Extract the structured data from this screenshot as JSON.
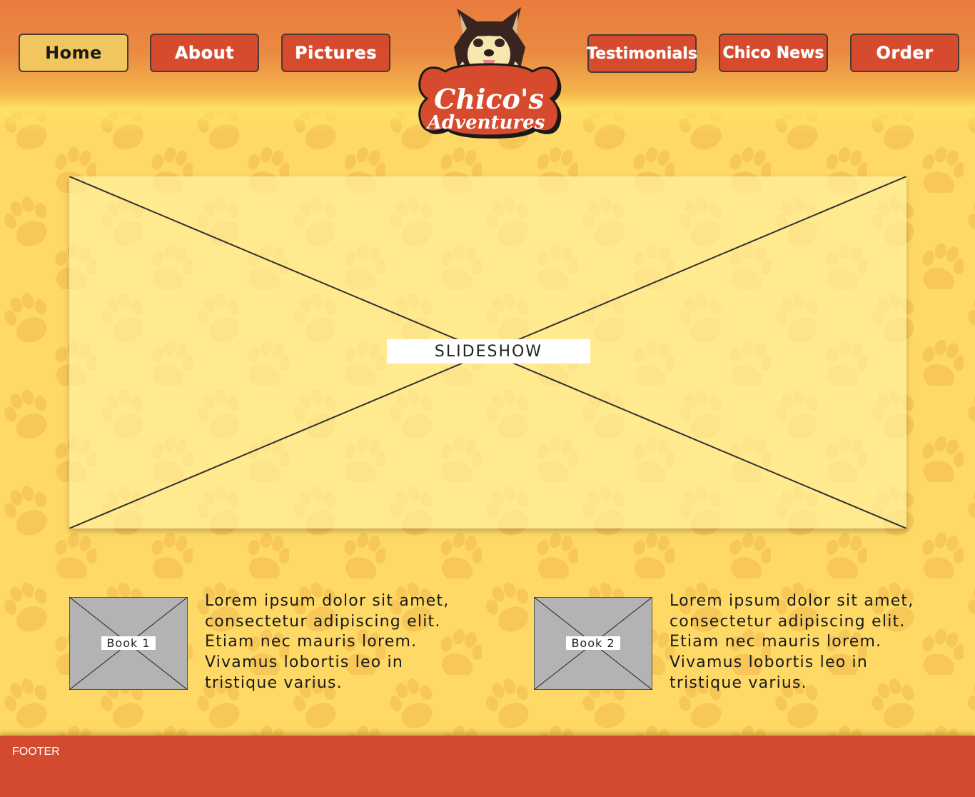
{
  "nav": {
    "home": "Home",
    "about": "About",
    "pictures": "Pictures",
    "testimonials": "Testimonials",
    "chico_news": "Chico News",
    "order": "Order"
  },
  "logo": {
    "line1": "Chico's",
    "line2": "Adventures"
  },
  "slideshow": {
    "label": "SLIDESHOW"
  },
  "books": [
    {
      "label": "Book 1",
      "text": "Lorem ipsum dolor sit amet, consectetur adipiscing elit. Etiam nec mauris lorem. Vivamus lobortis leo in tristique varius."
    },
    {
      "label": "Book 2",
      "text": "Lorem ipsum dolor sit amet, consectetur adipiscing elit. Etiam nec mauris lorem. Vivamus lobortis leo in tristique varius."
    }
  ],
  "footer": {
    "label": "FOOTER"
  },
  "colors": {
    "nav_button": "#d64a2d",
    "nav_active": "#f2c65e",
    "background": "#ffd966",
    "footer": "#d44a2e",
    "header_top": "#e97c3e"
  }
}
